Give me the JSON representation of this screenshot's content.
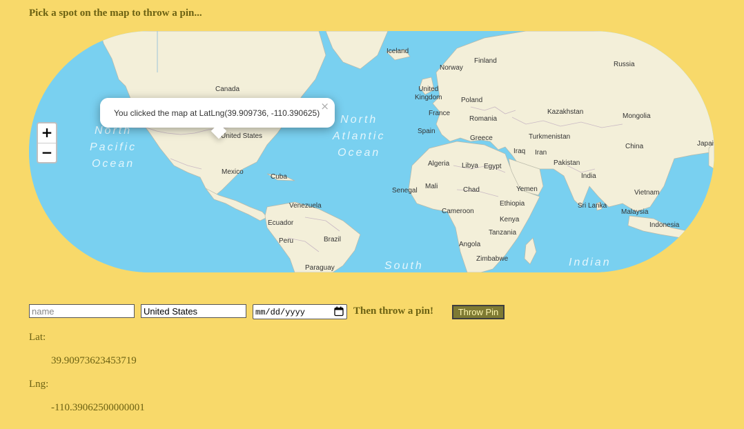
{
  "prompt": "Pick a spot on the map to throw a pin...",
  "map": {
    "zoom_in": "+",
    "zoom_out": "−",
    "popup": {
      "text": "You clicked the map at LatLng(39.909736, -110.390625)",
      "close": "×"
    },
    "labels": {
      "iceland": "Iceland",
      "norway": "Norway",
      "finland": "Finland",
      "russia": "Russia",
      "canada": "Canada",
      "united_kingdom": "United\nKingdom",
      "poland": "Poland",
      "kazakhstan": "Kazakhstan",
      "mongolia": "Mongolia",
      "france": "France",
      "romania": "Romania",
      "spain": "Spain",
      "greece": "Greece",
      "turkmenistan": "Turkmenistan",
      "china": "China",
      "japan": "Japai",
      "united_states": "United States",
      "iraq": "Iraq",
      "iran": "Iran",
      "algeria": "Algeria",
      "libya": "Libya",
      "egypt": "Egypt",
      "pakistan": "Pakistan",
      "india": "India",
      "mexico": "Mexico",
      "cuba": "Cuba",
      "senegal": "Senegal",
      "mali": "Mali",
      "chad": "Chad",
      "yemen": "Yemen",
      "vietnam": "Vietnam",
      "venezuela": "Venezuela",
      "cameroon": "Cameroon",
      "ethiopia": "Ethiopia",
      "sri_lanka": "Sri Lanka",
      "malaysia": "Malaysia",
      "ecuador": "Ecuador",
      "kenya": "Kenya",
      "indonesia": "Indonesia",
      "tanzania": "Tanzania",
      "peru": "Peru",
      "brazil": "Brazil",
      "angola": "Angola",
      "zimbabwe": "Zimbabwe",
      "paraguay": "Paraguay"
    },
    "oceans": {
      "north_pacific": "North\nPacific\nOcean",
      "north_atlantic": "North\nAtlantic\nOcean",
      "south": "South",
      "indian": "Indian"
    }
  },
  "form": {
    "name_placeholder": "name",
    "country_value": "United States",
    "date_placeholder": "mm/dd/yyyy",
    "then_text": "Then throw a pin!",
    "throw_button": "Throw Pin"
  },
  "coords": {
    "lat_label": "Lat:",
    "lat_value": "39.90973623453719",
    "lng_label": "Lng:",
    "lng_value": "-110.39062500000001"
  },
  "colors": {
    "page_background": "#f8d96a",
    "ocean": "#79d0f0",
    "land": "#f3efd9",
    "text": "#6b6112",
    "button": "#7e7a33"
  }
}
